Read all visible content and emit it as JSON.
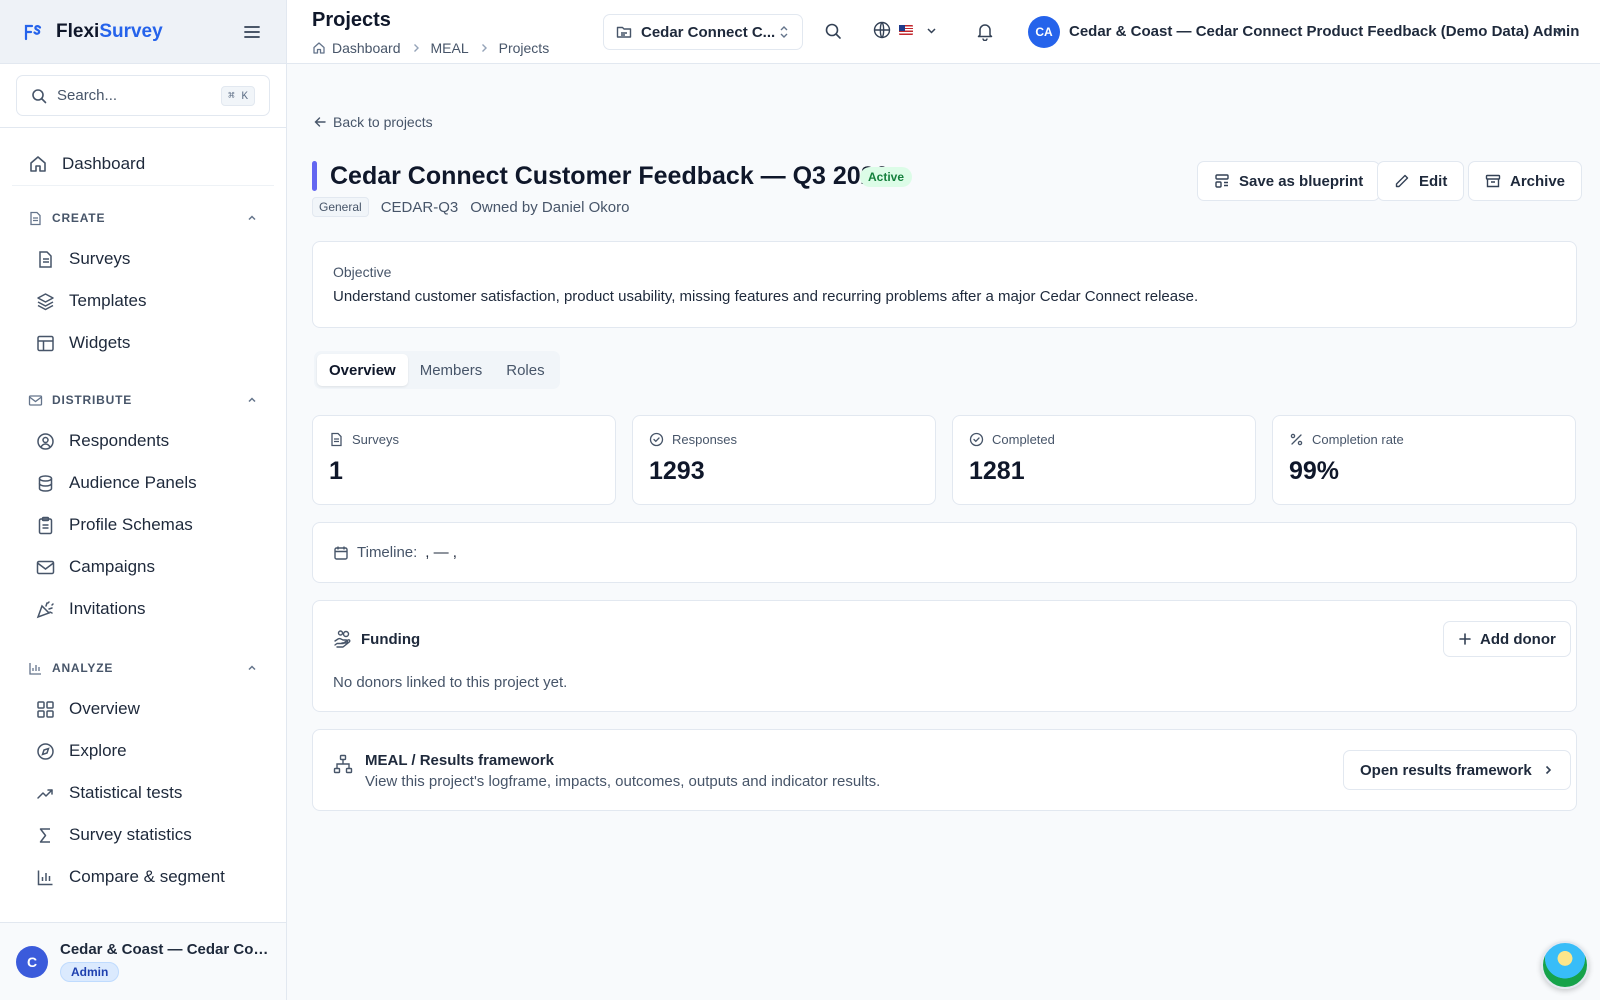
{
  "brand": {
    "name_part1": "Flexi",
    "name_part2": "Survey"
  },
  "sidebar": {
    "search_placeholder": "Search...",
    "search_shortcut": "⌘ K",
    "dashboard": "Dashboard",
    "sections": [
      {
        "title": "CREATE",
        "items": [
          "Surveys",
          "Templates",
          "Widgets"
        ]
      },
      {
        "title": "DISTRIBUTE",
        "items": [
          "Respondents",
          "Audience Panels",
          "Profile Schemas",
          "Campaigns",
          "Invitations"
        ]
      },
      {
        "title": "ANALYZE",
        "items": [
          "Overview",
          "Explore",
          "Statistical tests",
          "Survey statistics",
          "Compare & segment"
        ]
      }
    ],
    "footer": {
      "avatar_initial": "C",
      "name": "Cedar & Coast — Cedar Connect Product Feedback (Demo Data) Admin",
      "role": "Admin"
    }
  },
  "header": {
    "title": "Projects",
    "breadcrumbs": [
      "Dashboard",
      "MEAL",
      "Projects"
    ],
    "project_select": "Cedar Connect C...",
    "user_initials": "CA",
    "user_name": "Cedar & Coast — Cedar Connect Product Feedback (Demo Data) Admin"
  },
  "project": {
    "back_label": "Back to projects",
    "title": "Cedar Connect Customer Feedback — Q3 2026",
    "status": "Active",
    "category": "General",
    "code": "CEDAR-Q3",
    "owner": "Owned by Daniel Okoro",
    "actions": {
      "blueprint": "Save as blueprint",
      "edit": "Edit",
      "archive": "Archive"
    },
    "objective_label": "Objective",
    "objective_text": "Understand customer satisfaction, product usability, missing features and recurring problems after a major Cedar Connect release.",
    "tabs": [
      "Overview",
      "Members",
      "Roles"
    ],
    "stats": [
      {
        "label": "Surveys",
        "value": "1",
        "icon": "document-icon"
      },
      {
        "label": "Responses",
        "value": "1293",
        "icon": "check-circle-icon"
      },
      {
        "label": "Completed",
        "value": "1281",
        "icon": "check-circle-icon"
      },
      {
        "label": "Completion rate",
        "value": "99%",
        "icon": "percent-icon"
      }
    ],
    "timeline_label": "Timeline:",
    "timeline_value": ", — ,",
    "funding": {
      "title": "Funding",
      "add_label": "Add donor",
      "empty": "No donors linked to this project yet."
    },
    "meal": {
      "title": "MEAL / Results framework",
      "desc": "View this project's logframe, impacts, outcomes, outputs and indicator results.",
      "button": "Open results framework"
    }
  },
  "colors": {
    "brand": "#2563eb",
    "accent_bar": "#6366f1",
    "status_active": "#15803d"
  }
}
